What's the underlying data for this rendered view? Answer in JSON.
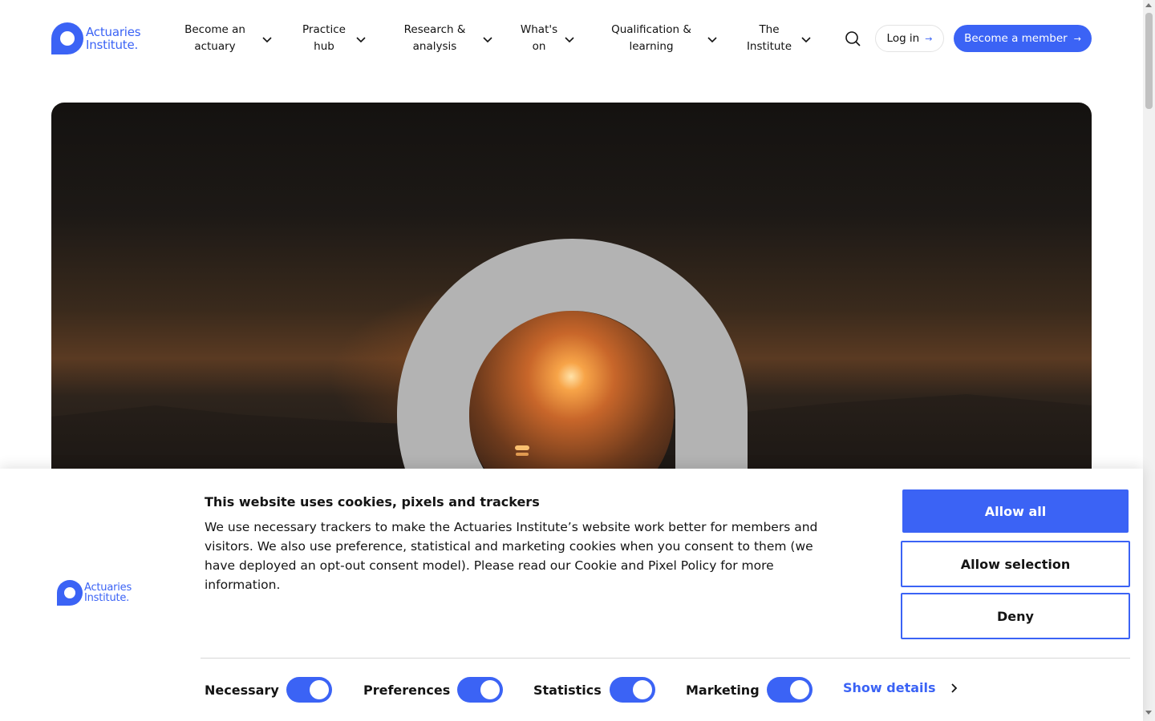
{
  "brand": {
    "line1": "Actuaries",
    "line2": "Institute.",
    "color": "#3b63f5"
  },
  "nav": {
    "items": [
      {
        "line1": "Become an",
        "line2": "actuary"
      },
      {
        "line1": "Practice",
        "line2": "hub"
      },
      {
        "line1": "Research &",
        "line2": "analysis"
      },
      {
        "line1": "What's",
        "line2": "on"
      },
      {
        "line1": "Qualification &",
        "line2": "learning"
      },
      {
        "line1": "The",
        "line2": "Institute"
      }
    ],
    "login_label": "Log in",
    "member_label": "Become a member"
  },
  "cookie_banner": {
    "title": "This website uses cookies, pixels and trackers",
    "text": "We use necessary trackers to make the Actuaries Institute’s website work better for members and visitors. We also use preference, statistical and marketing cookies when you consent to them (we have deployed an opt-out consent model). Please read our Cookie and Pixel Policy for more information.",
    "allow_all": "Allow all",
    "allow_selection": "Allow selection",
    "deny": "Deny",
    "toggles": [
      {
        "label": "Necessary",
        "on": true
      },
      {
        "label": "Preferences",
        "on": true
      },
      {
        "label": "Statistics",
        "on": true
      },
      {
        "label": "Marketing",
        "on": true
      }
    ],
    "show_details": "Show details"
  }
}
